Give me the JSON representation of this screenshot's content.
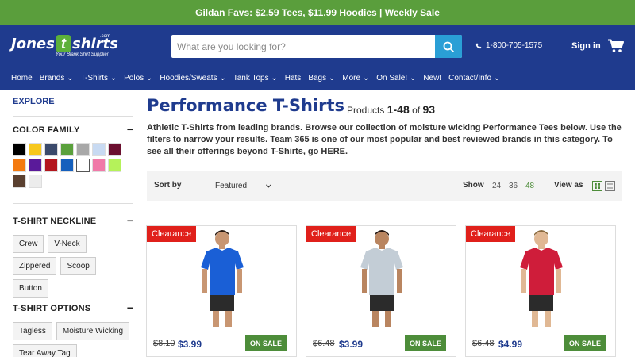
{
  "promo": {
    "text": "Gildan Favs: $2.59 Tees, $11.99 Hoodies | Weekly Sale"
  },
  "header": {
    "logo_jones": "Jones",
    "logo_t": "t",
    "logo_shirts": "shirts",
    "logo_dotcom": ".com",
    "logo_tagline": "Your Blank Shirt Supplier",
    "search_placeholder": "What are you looking for?",
    "phone": "1-800-705-1575",
    "signin": "Sign in"
  },
  "nav": [
    "Home",
    "Brands ⌄",
    "T-Shirts ⌄",
    "Polos ⌄",
    "Hoodies/Sweats ⌄",
    "Tank Tops ⌄",
    "Hats",
    "Bags ⌄",
    "More ⌄",
    "On Sale! ⌄",
    "New!",
    "Contact/Info ⌄"
  ],
  "sidebar": {
    "explore": "EXPLORE",
    "color_family": "COLOR FAMILY",
    "swatches": [
      "#000000",
      "#f7c81e",
      "#3b4a6b",
      "#5aa03c",
      "#a8a8a8",
      "#c8daf2",
      "#6b0f2f",
      "#f47a10",
      "#5a1a9a",
      "#b3161d",
      "#1560bd",
      "#ffffff",
      "#f07aa8",
      "#b5f25a",
      "#5a4030",
      "#ececec"
    ],
    "neckline_title": "T-SHIRT NECKLINE",
    "neckline": [
      "Crew",
      "V-Neck",
      "Zippered",
      "Scoop",
      "Button"
    ],
    "options_title": "T-SHIRT OPTIONS",
    "options": [
      "Tagless",
      "Moisture Wicking",
      "Tear Away Tag"
    ],
    "minus": "−"
  },
  "main": {
    "title": "Performance T-Shirts",
    "count_prefix": "Products",
    "count_range": "1-48",
    "count_of": "of",
    "count_total": "93",
    "description": "Athletic T-Shirts from leading brands. Browse our collection of moisture wicking Performance Tees below. Use the filters to narrow your results. Team 365 is one of our most popular and best reviewed brands in this category. To see all their offerings beyond T-Shirts, go HERE.",
    "sort_label": "Sort by",
    "sort_value": "Featured",
    "show_label": "Show",
    "show_options": [
      "24",
      "36",
      "48"
    ],
    "view_label": "View as"
  },
  "products": [
    {
      "tag": "Clearance",
      "was": "$8.10",
      "now": "$3.99",
      "badge": "ON SALE",
      "shirt_color": "#1a5fd6",
      "shorts_color": "#2b2b2b"
    },
    {
      "tag": "Clearance",
      "was": "$6.48",
      "now": "$3.99",
      "badge": "ON SALE",
      "shirt_color": "#c3cdd6",
      "shorts_color": "#2b2b2b"
    },
    {
      "tag": "Clearance",
      "was": "$6.48",
      "now": "$4.99",
      "badge": "ON SALE",
      "shirt_color": "#cf1d3a",
      "shorts_color": "#2b2b2b"
    }
  ]
}
